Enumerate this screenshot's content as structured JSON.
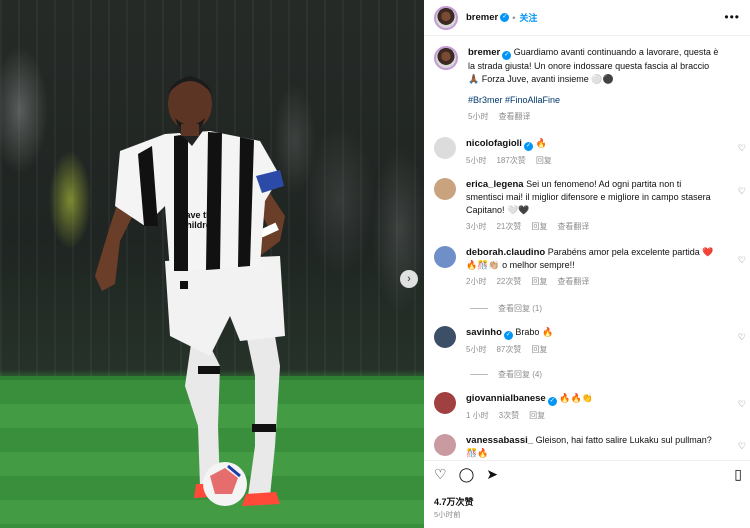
{
  "post": {
    "author": "bremer",
    "follow_label": "关注",
    "more_label": "•••",
    "caption_author": "bremer",
    "caption": "Guardiamo avanti continuando a lavorare, questa è la strada giusta! Un onore indossare questa fascia al braccio 🙏🏾 Forza Juve, avanti insieme ⚪⚫",
    "hashtags": "#Br3mer #FinoAllaFine",
    "caption_time": "5小时",
    "caption_translate": "查看翻译",
    "likes": "4.7万次赞",
    "posted": "5小时前"
  },
  "photo": {
    "shirt_text_1": "Save the",
    "shirt_text_2": "Children",
    "next_arrow": "›"
  },
  "comments": [
    {
      "user": "nicolofagioli",
      "text": "🔥",
      "time": "5小时",
      "likes": "187次赞",
      "reply": "回复",
      "avatar_color": "#d8d8d8"
    },
    {
      "user": "erica_legena",
      "text": "Sei un fenomeno! Ad ogni partita non ti smentisci mai! il miglior difensore e migliore in campo stasera Capitano! 🤍🖤",
      "time": "3小时",
      "likes": "21次赞",
      "reply": "回复",
      "translate": "查看翻译",
      "avatar_color": "#c9a27e"
    },
    {
      "user": "deborah.claudino",
      "text": "Parabéns amor pela excelente partida ❤️🔥🎊👏🏼 o melhor sempre!!",
      "time": "2小时",
      "likes": "22次赞",
      "reply": "回复",
      "translate": "查看翻译",
      "more_replies": "查看回复 (1)",
      "avatar_color": "#6f8fc8"
    },
    {
      "user": "savinho",
      "text": "Brabo 🔥",
      "time": "5小时",
      "likes": "87次赞",
      "reply": "回复",
      "more_replies": "查看回复 (4)",
      "avatar_color": "#3d4f66"
    },
    {
      "user": "giovannialbanese",
      "text": "🔥🔥👏",
      "time": "1 小时",
      "likes": "3次赞",
      "reply": "回复",
      "avatar_color": "#a04040"
    },
    {
      "user": "vanessabassi_",
      "text": "Gleison, hai fatto salire Lukaku sul pullman? 🎊🔥",
      "avatar_color": "#c99aa0"
    }
  ],
  "icons": {
    "heart": "♡",
    "comment": "◯",
    "share": "➤",
    "bookmark": "▯"
  },
  "colors": {
    "link": "#0095f6",
    "hashtag": "#00376b",
    "meta": "#8e8e8e"
  }
}
